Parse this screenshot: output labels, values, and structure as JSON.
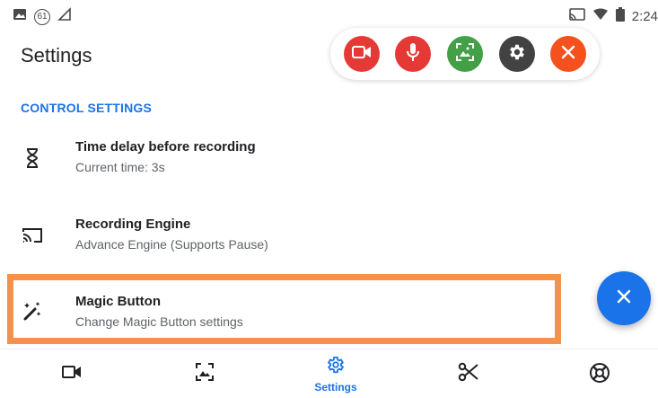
{
  "status_bar": {
    "notification_count": "61",
    "time": "2:24",
    "icons": [
      "image-icon",
      "notification-count-badge",
      "network-icon",
      "cast-icon",
      "wifi-icon",
      "battery-icon"
    ]
  },
  "header": {
    "title": "Settings"
  },
  "toolbar": {
    "buttons": [
      {
        "name": "record-video-icon",
        "color": "#e53935"
      },
      {
        "name": "microphone-icon",
        "color": "#e53935"
      },
      {
        "name": "screenshot-icon",
        "color": "#43a047"
      },
      {
        "name": "settings-gear-icon",
        "color": "#424242"
      },
      {
        "name": "close-icon",
        "color": "#f4511e"
      }
    ]
  },
  "section": {
    "title": "CONTROL SETTINGS"
  },
  "settings": [
    {
      "icon": "hourglass-icon",
      "title": "Time delay before recording",
      "subtitle": "Current time: 3s"
    },
    {
      "icon": "cast-screen-icon",
      "title": "Recording Engine",
      "subtitle": "Advance Engine (Supports Pause)"
    },
    {
      "icon": "magic-wand-icon",
      "title": "Magic Button",
      "subtitle": "Change Magic Button settings"
    }
  ],
  "fab": {
    "icon": "close-icon",
    "color": "#1a73e8"
  },
  "bottom_nav": {
    "items": [
      {
        "icon": "video-camera-icon",
        "label": ""
      },
      {
        "icon": "image-icon",
        "label": ""
      },
      {
        "icon": "settings-gear-icon",
        "label": "Settings"
      },
      {
        "icon": "scissors-icon",
        "label": ""
      },
      {
        "icon": "lifebuoy-icon",
        "label": ""
      }
    ],
    "active_color": "#1a73e8"
  },
  "colors": {
    "accent": "#1a73e8",
    "highlight": "#f4924c"
  }
}
